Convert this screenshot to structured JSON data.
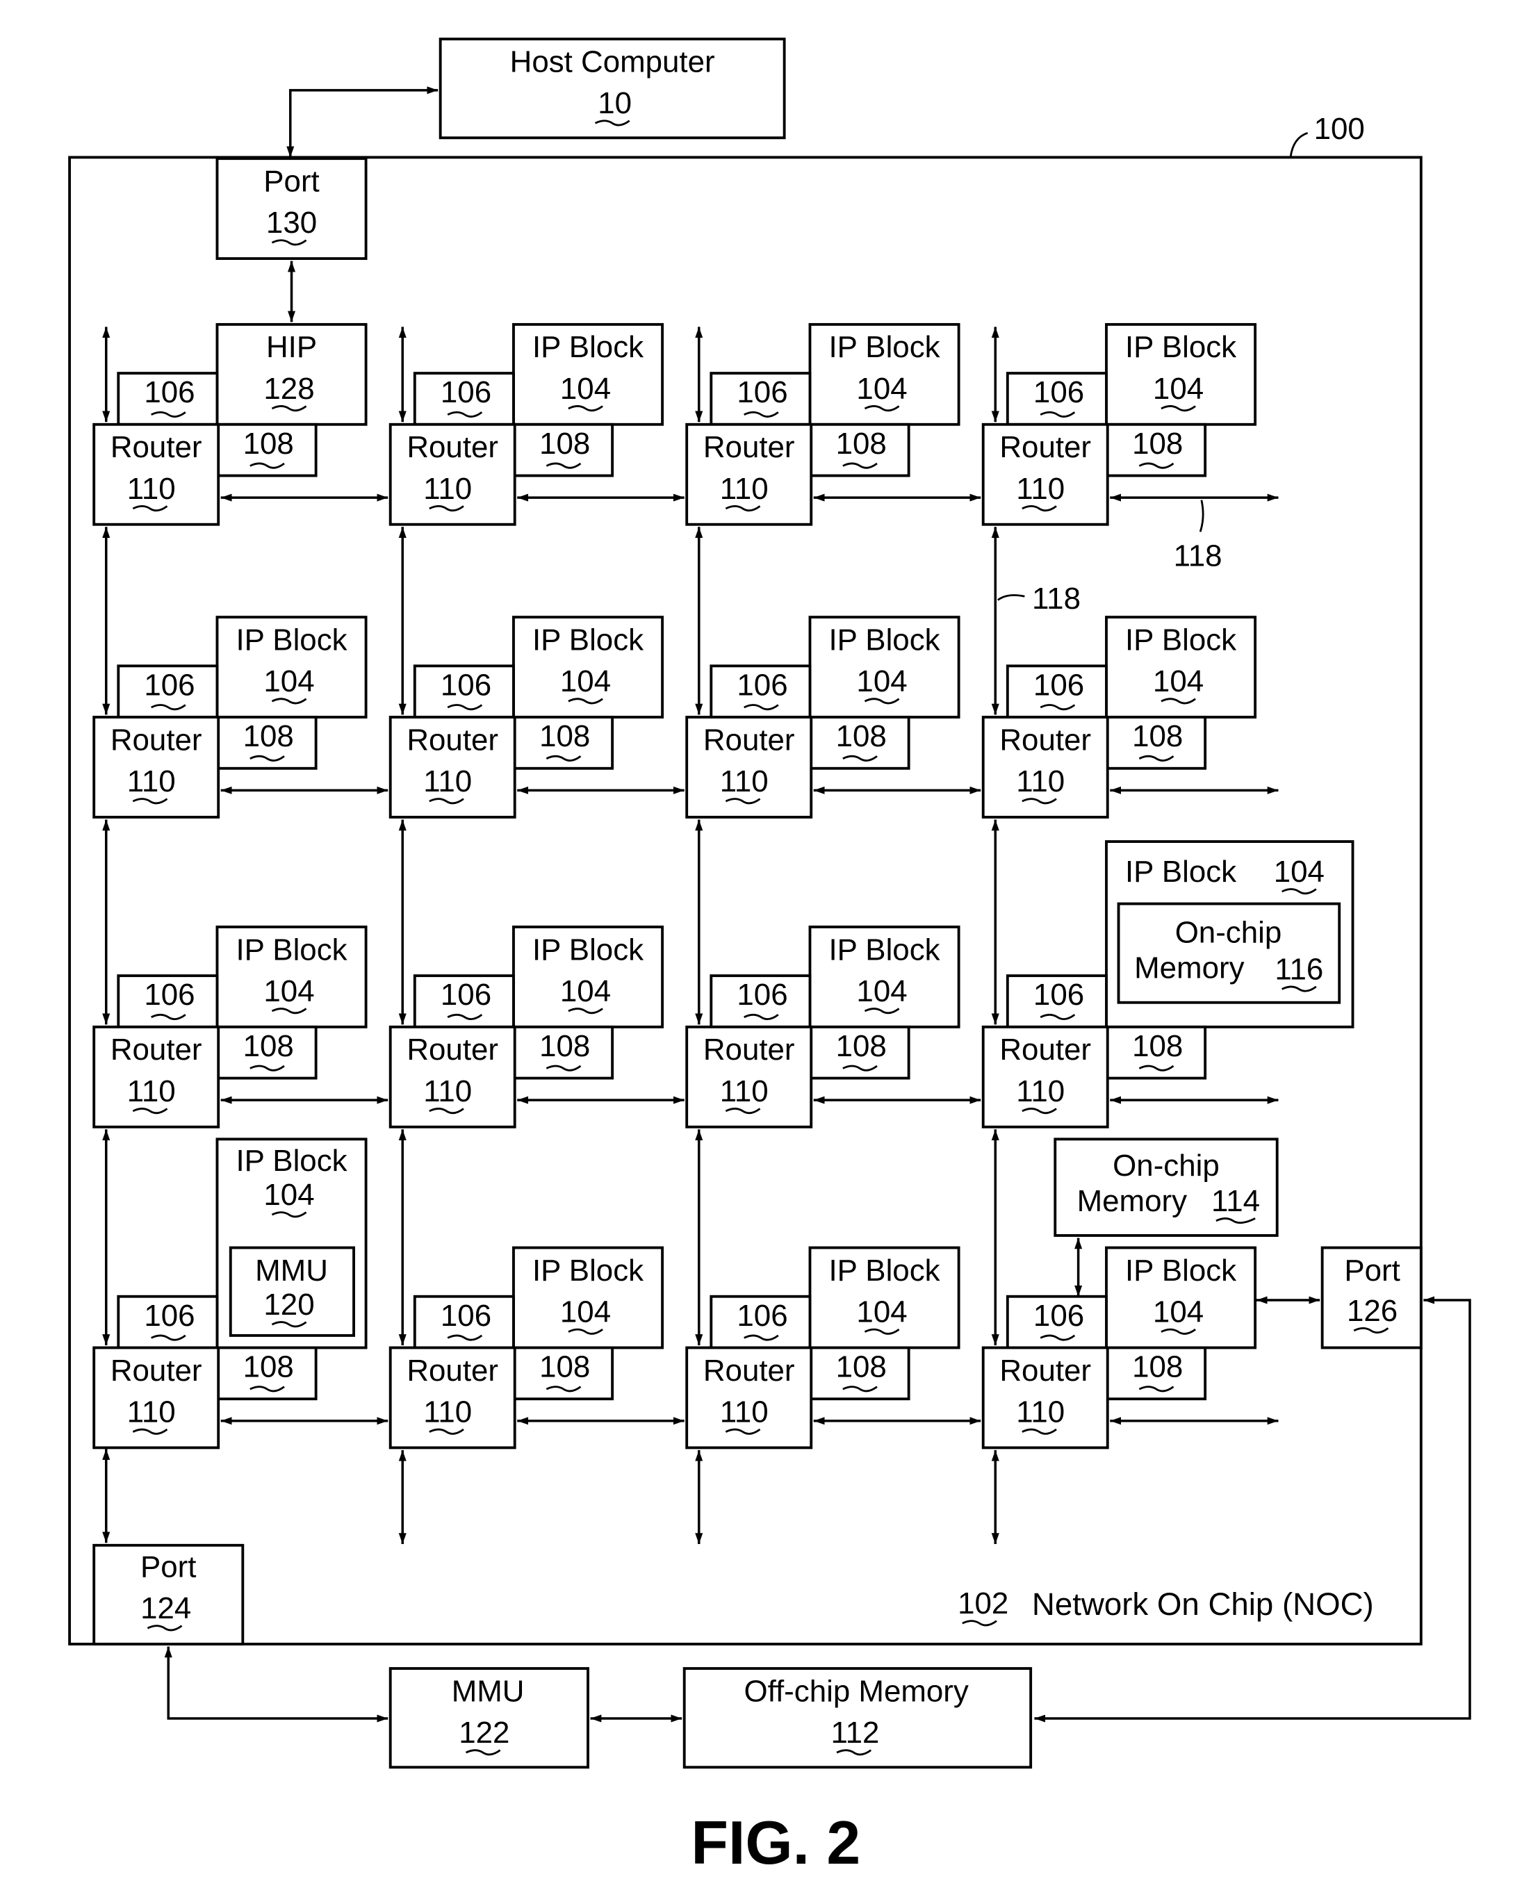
{
  "figure": {
    "caption": "FIG. 2",
    "system_ref": "100",
    "noc_ref": "102",
    "noc_label": "Network On Chip (NOC)",
    "link_ref": "118"
  },
  "host": {
    "label": "Host Computer",
    "ref": "10"
  },
  "ports": {
    "host_port": {
      "label": "Port",
      "ref": "130"
    },
    "mem_port": {
      "label": "Port",
      "ref": "124"
    },
    "right_port": {
      "label": "Port",
      "ref": "126"
    }
  },
  "external": {
    "mmu": {
      "label": "MMU",
      "ref": "122"
    },
    "offchip": {
      "label": "Off-chip Memory",
      "ref": "112"
    }
  },
  "node_labels": {
    "router": "Router",
    "router_ref": "110",
    "mem_iface_ref": "106",
    "net_iface_ref": "108",
    "ip_block": "IP Block",
    "ip_ref": "104",
    "hip": "HIP",
    "hip_ref": "128"
  },
  "onchip_116": {
    "line1": "On-chip",
    "line2": "Memory",
    "ref": "116",
    "parent_label": "IP Block",
    "parent_ref": "104"
  },
  "onchip_114": {
    "line1": "On-chip",
    "line2": "Memory",
    "ref": "114"
  },
  "mmu_120": {
    "label": "MMU",
    "ref": "120",
    "parent_label": "IP Block",
    "parent_ref": "104"
  }
}
